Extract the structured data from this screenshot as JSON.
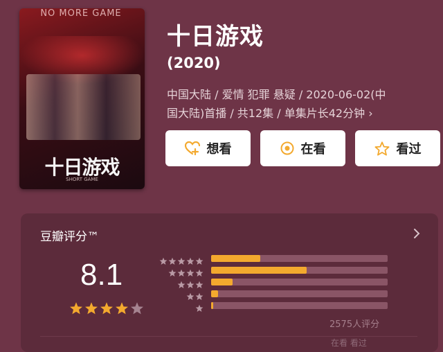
{
  "poster": {
    "neon_text": "NO MORE GAME",
    "title_art": "十日游戏",
    "sub_text": "SHORT GAME"
  },
  "show": {
    "title": "十日游戏",
    "year": "(2020)",
    "meta_line1": "中国大陆 / 爱情 犯罪 悬疑 / 2020-06-02(中",
    "meta_line2": "国大陆)首播 / 共12集 / 单集片长42分钟",
    "meta_chevron": "›"
  },
  "actions": [
    {
      "label": "想看",
      "icon": "heart-plus-icon"
    },
    {
      "label": "在看",
      "icon": "target-circle-icon"
    },
    {
      "label": "看过",
      "icon": "star-outline-icon"
    }
  ],
  "rating": {
    "header": "豆瓣评分™",
    "score": "8.1",
    "stars_filled": 4,
    "stars_total": 5,
    "count_text": "2575人评分",
    "footer_partial": "在看 看过",
    "distribution": [
      {
        "stars": 5,
        "percent": 28
      },
      {
        "stars": 4,
        "percent": 54
      },
      {
        "stars": 3,
        "percent": 12
      },
      {
        "stars": 2,
        "percent": 4
      },
      {
        "stars": 1,
        "percent": 1
      }
    ]
  },
  "colors": {
    "background": "#6e3447",
    "accent": "#f3a92e",
    "card": "#5c2b3b"
  }
}
